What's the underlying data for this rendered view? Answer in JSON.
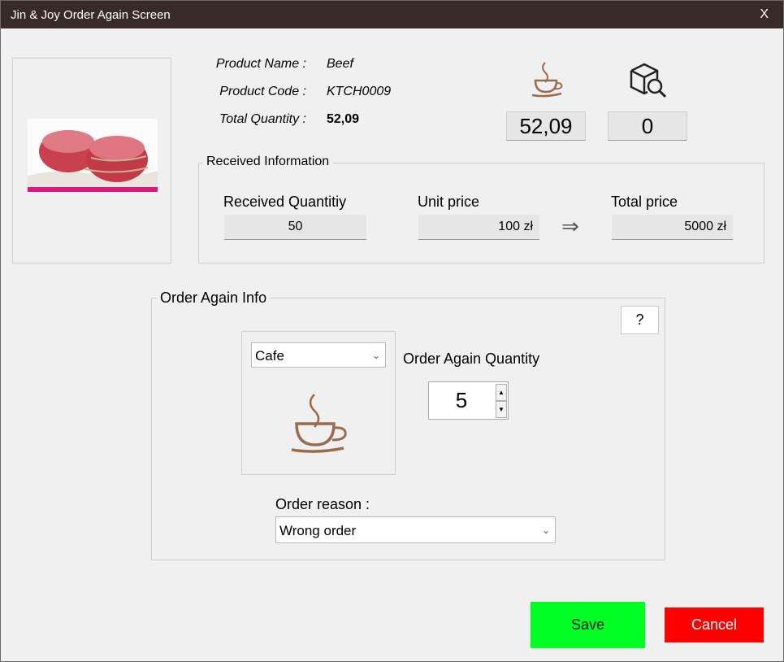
{
  "window": {
    "title": "Jin & Joy Order Again Screen",
    "close_label": "X"
  },
  "product": {
    "name_label": "Product Name :",
    "name": "Beef",
    "code_label": "Product Code :",
    "code": "KTCH0009",
    "total_qty_label": "Total Quantity :",
    "total_qty": "52,09",
    "image_icon": "beef-photo"
  },
  "stats": {
    "cafe_value": "52,09",
    "search_value": "0",
    "cafe_icon": "cafe-cup-icon",
    "search_icon": "box-search-icon"
  },
  "received": {
    "title": "Received Information",
    "qty_label": "Received Quantitiy",
    "qty": "50",
    "unit_price_label": "Unit price",
    "unit_price": "100 zł",
    "arrow": "⇒",
    "total_price_label": "Total price",
    "total_price": "5000 zł"
  },
  "order_again": {
    "title": "Order Again Info",
    "help_label": "?",
    "location_selected": "Cafe",
    "quantity_label": "Order Again Quantity",
    "quantity": "5",
    "reason_label": "Order reason :",
    "reason_selected": "Wrong order"
  },
  "actions": {
    "save_label": "Save",
    "cancel_label": "Cancel"
  },
  "colors": {
    "titlebar": "#382a27",
    "save": "#00ff22",
    "cancel": "#ff0000",
    "cup": "#9a6b4e"
  }
}
